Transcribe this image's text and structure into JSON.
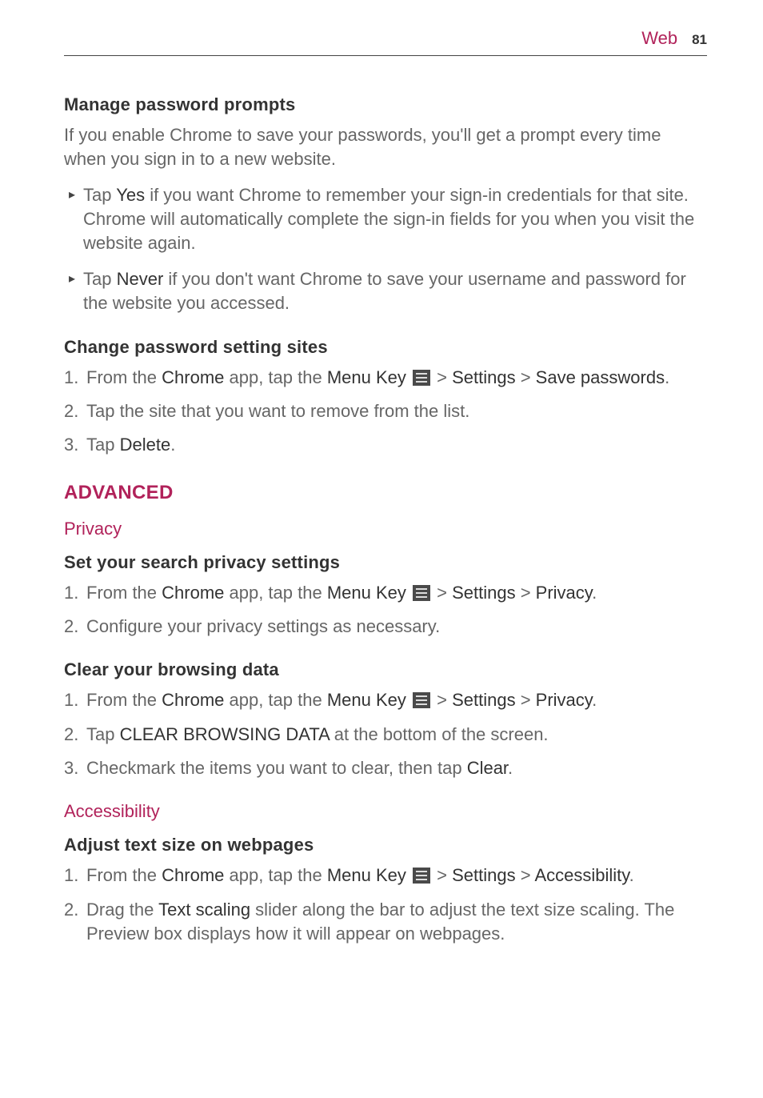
{
  "header": {
    "section": "Web",
    "page": "81"
  },
  "s1": {
    "title": "Manage password prompts",
    "intro": "If you enable Chrome to save your passwords, you'll get a prompt every time when you sign in to a new website.",
    "b1": {
      "pre": "Tap ",
      "bold": "Yes",
      "post": " if you want Chrome to remember your sign-in credentials for that site. Chrome will automatically complete the sign-in fields for you when you visit the website again."
    },
    "b2": {
      "pre": "Tap ",
      "bold": "Never",
      "post": " if you don't want Chrome to save your username and password for the website you accessed."
    }
  },
  "s2": {
    "title": "Change password setting sites",
    "n1": {
      "a": "From the ",
      "b": "Chrome",
      "c": " app, tap the ",
      "d": "Menu Key",
      "e": " > ",
      "f": "Settings",
      "g": " > ",
      "h": "Save passwords",
      "i": "."
    },
    "n2": "Tap the site that you want to remove from the list.",
    "n3": {
      "a": "Tap ",
      "b": "Delete",
      "c": "."
    }
  },
  "advanced": "ADVANCED",
  "privacy": "Privacy",
  "s3": {
    "title": "Set your search privacy settings",
    "n1": {
      "a": "From the ",
      "b": "Chrome",
      "c": " app, tap the ",
      "d": "Menu Key",
      "e": " > ",
      "f": "Settings",
      "g": " > ",
      "h": "Privacy",
      "i": "."
    },
    "n2": "Configure your privacy settings as necessary."
  },
  "s4": {
    "title": "Clear your browsing data",
    "n1": {
      "a": "From the ",
      "b": "Chrome",
      "c": " app, tap the ",
      "d": "Menu Key",
      "e": " > ",
      "f": "Settings",
      "g": " > ",
      "h": "Privacy",
      "i": "."
    },
    "n2": {
      "a": "Tap ",
      "b": "CLEAR BROWSING DATA",
      "c": " at the bottom of the screen."
    },
    "n3": {
      "a": "Checkmark the items you want to clear, then tap ",
      "b": "Clear",
      "c": "."
    }
  },
  "accessibility": "Accessibility",
  "s5": {
    "title": "Adjust text size on webpages",
    "n1": {
      "a": "From the ",
      "b": "Chrome",
      "c": " app, tap the ",
      "d": "Menu Key",
      "e": " > ",
      "f": "Settings",
      "g": " > ",
      "h": "Accessibility",
      "i": "."
    },
    "n2": {
      "a": "Drag the ",
      "b": "Text scaling",
      "c": " slider along the bar to adjust the text size scaling. The Preview box displays how it will appear on webpages."
    }
  },
  "nums": {
    "1": "1.",
    "2": "2.",
    "3": "3."
  },
  "bullet": "▸"
}
